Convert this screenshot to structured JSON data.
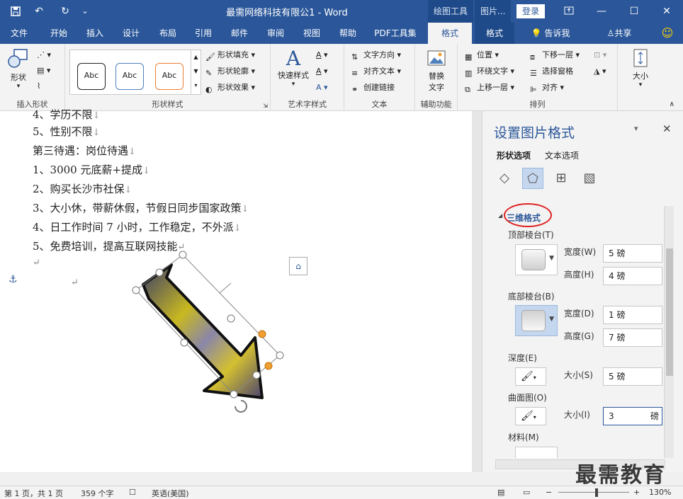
{
  "titlebar": {
    "document_title": "最需网络科技有限公1  -  Word",
    "context_tab_drawing": "绘图工具",
    "context_tab_picture": "图片...",
    "login": "登录",
    "customize": "⌄"
  },
  "tabs": [
    {
      "label": "文件"
    },
    {
      "label": "开始"
    },
    {
      "label": "插入"
    },
    {
      "label": "设计"
    },
    {
      "label": "布局"
    },
    {
      "label": "引用"
    },
    {
      "label": "邮件"
    },
    {
      "label": "审阅"
    },
    {
      "label": "视图"
    },
    {
      "label": "帮助"
    },
    {
      "label": "PDF工具集"
    },
    {
      "label": "格式"
    },
    {
      "label": "格式"
    },
    {
      "label": "告诉我"
    },
    {
      "label": "共享"
    }
  ],
  "ribbon": {
    "insert_shapes": {
      "shapes_label": "形状",
      "group_label": "插入形状"
    },
    "shape_styles": {
      "abc": [
        "Abc",
        "Abc",
        "Abc"
      ],
      "fill": "形状填充",
      "outline": "形状轮廓",
      "effects": "形状效果",
      "group_label": "形状样式"
    },
    "wordart": {
      "quick_styles": "快速样式",
      "group_label": "艺术字样式",
      "text_a": "A"
    },
    "text": {
      "direction": "文字方向",
      "align": "对齐文本",
      "link": "创建链接",
      "group_label": "文本"
    },
    "accessibility": {
      "alt_text_line1": "替换",
      "alt_text_line2": "文字",
      "group_label": "辅助功能"
    },
    "arrange": {
      "position": "位置",
      "wrap": "环绕文字",
      "forward": "上移一层",
      "backward": "下移一层",
      "selection_pane": "选择窗格",
      "align": "对齐",
      "group_label": "排列"
    },
    "size": {
      "label": "大小"
    }
  },
  "document": {
    "lines": [
      "4、学历不限",
      "5、性别不限",
      "第三待遇：岗位待遇",
      "1、3000 元底薪+提成",
      "2、购买长沙市社保",
      "3、大小休，带薪休假，节假日同步国家政策",
      "4、日工作时间 7 小时，工作稳定，不外派",
      "5、免费培训，提高互联网技能"
    ],
    "para_mark": "↵",
    "line_mark": "↓"
  },
  "pane": {
    "title": "设置图片格式",
    "tabs": [
      "形状选项",
      "文本选项"
    ],
    "section": "三维格式",
    "top_bevel": {
      "label": "顶部棱台(T)",
      "width_label": "宽度(W)",
      "width": "5 磅",
      "height_label": "高度(H)",
      "height": "4 磅"
    },
    "bottom_bevel": {
      "label": "底部棱台(B)",
      "width_label": "宽度(D)",
      "width": "1 磅",
      "height_label": "高度(G)",
      "height": "7 磅"
    },
    "depth": {
      "label": "深度(E)",
      "size_label": "大小(S)",
      "size": "5 磅"
    },
    "contour": {
      "label": "曲面图(O)",
      "size_label": "大小(I)",
      "size": "3",
      "unit": "磅"
    },
    "material": {
      "label": "材料(M)"
    }
  },
  "status": {
    "page": "第 1 页，共 1 页",
    "words": "359 个字",
    "language": "英语(美国)",
    "zoom": "130%",
    "minus": "−",
    "plus": "+"
  },
  "watermark": "最需教育",
  "colors": {
    "accent": "#2b579a",
    "highlight": "#e02020"
  }
}
